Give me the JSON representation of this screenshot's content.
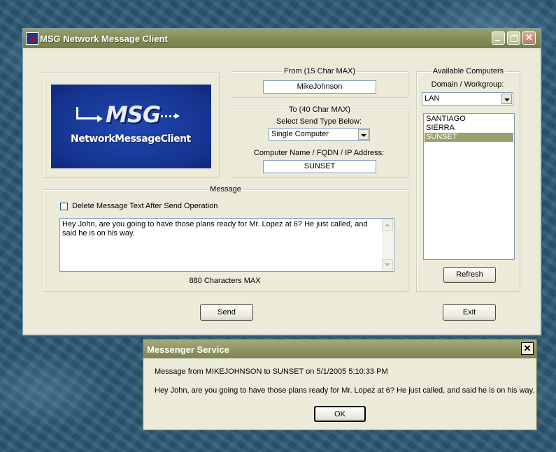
{
  "window": {
    "title": "MSG Network Message Client",
    "minimize_icon": "minimize-icon",
    "maximize_icon": "maximize-icon",
    "close_label": "✕"
  },
  "logo": {
    "main_text": "MSG",
    "sub_text": "NetworkMessageClient"
  },
  "from_group": {
    "legend": "From (15 Char MAX)",
    "value": "MikeJohnson"
  },
  "to_group": {
    "legend": "To (40 Char MAX)",
    "send_type_label": "Select Send Type Below:",
    "send_type_value": "Single Computer",
    "computer_label": "Computer Name / FQDN / IP Address:",
    "computer_value": "SUNSET"
  },
  "available": {
    "legend": "Available Computers",
    "domain_label": "Domain / Workgroup:",
    "domain_value": "LAN",
    "computers": [
      "SANTIAGO",
      "SIERRA",
      "SUNSET"
    ],
    "selected": "SUNSET",
    "refresh_label": "Refresh"
  },
  "message_group": {
    "legend": "Message",
    "delete_checkbox_label": "Delete Message Text After Send Operation",
    "text": "Hey John, are you going to have those plans ready for Mr. Lopez at 6? He just called, and said he is on his way.",
    "max_label": "880 Characters MAX"
  },
  "buttons": {
    "send": "Send",
    "exit": "Exit"
  },
  "dialog": {
    "title": "Messenger Service",
    "close_label": "✕",
    "header_line": "Message from MIKEJOHNSON to SUNSET on 5/1/2005 5:10:33 PM",
    "body_line": "Hey John, are you going to have those plans ready for Mr. Lopez at 6? He just called, and said he is on his way.",
    "ok_label": "OK"
  },
  "colors": {
    "titlebar": "#8b9460",
    "selection": "#9aa06e",
    "window_bg": "#ecead9",
    "logo_bg": "#163591"
  }
}
